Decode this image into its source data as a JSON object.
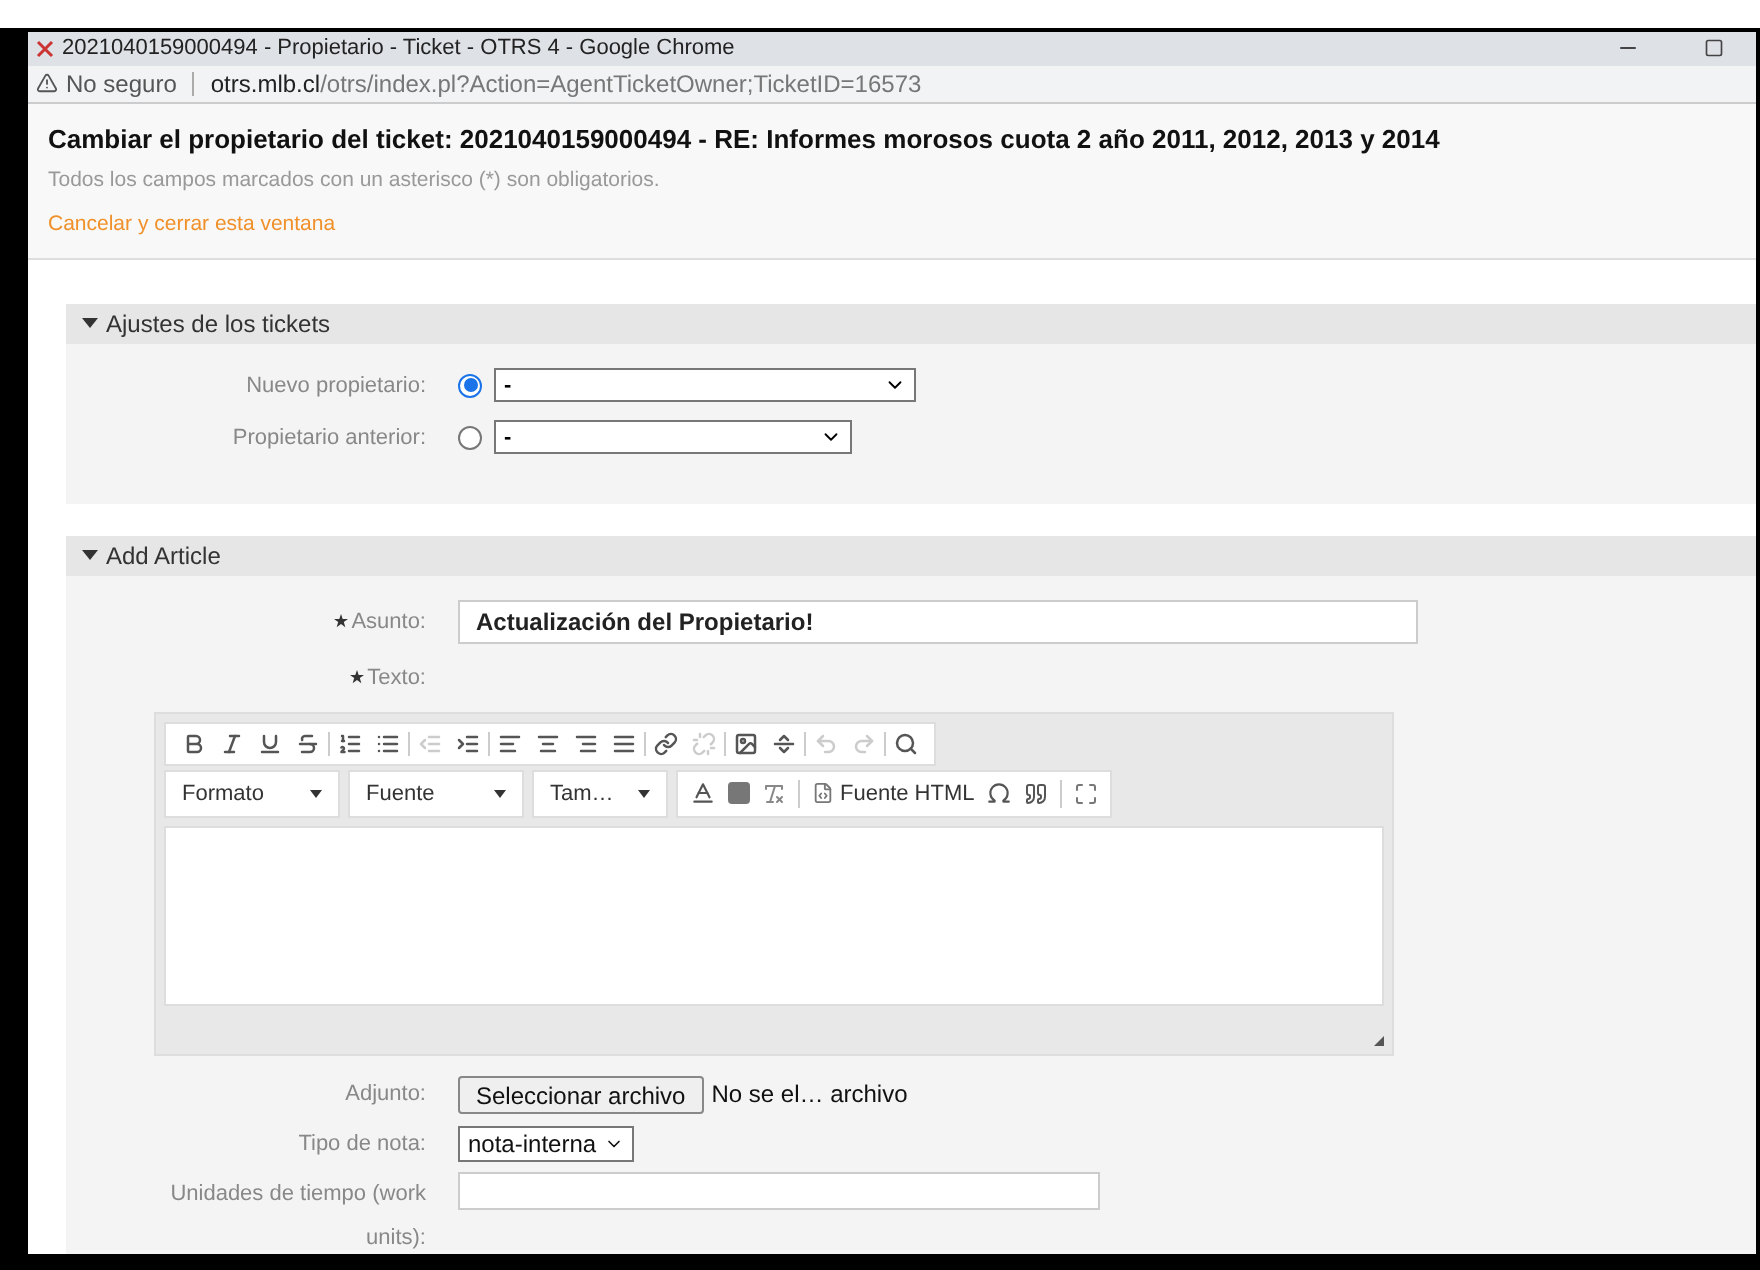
{
  "window": {
    "title": "2021040159000494 - Propietario - Ticket - OTRS 4 - Google Chrome"
  },
  "address_bar": {
    "security": "No seguro",
    "host": "otrs.mlb.cl",
    "path": "/otrs/index.pl?Action=AgentTicketOwner;TicketID=16573"
  },
  "header": {
    "title": "Cambiar el propietario del ticket: 2021040159000494 - RE: Informes morosos cuota 2 año 2011, 2012, 2013 y 2014",
    "note": "Todos los campos marcados con un asterisco (*) son obligatorios.",
    "cancel_link": "Cancelar y cerrar esta ventana"
  },
  "settings_section": {
    "title": "Ajustes de los tickets",
    "expanded": true,
    "fields": [
      {
        "label": "Nuevo propietario:",
        "selected": true,
        "value": "-"
      },
      {
        "label": "Propietario anterior:",
        "selected": false,
        "value": "-"
      }
    ]
  },
  "article_section": {
    "title": "Add Article",
    "expanded": true,
    "subject": {
      "label": "Asunto:",
      "required": true,
      "value": "Actualización del Propietario!"
    },
    "text": {
      "label": "Texto:",
      "required": true
    },
    "toolbar": [
      [
        {
          "kind": "bold",
          "disabled": false
        },
        {
          "kind": "italic",
          "disabled": false
        },
        {
          "kind": "underline",
          "disabled": false
        },
        {
          "kind": "strike",
          "disabled": false
        }
      ],
      [
        {
          "kind": "ordered-list",
          "disabled": false
        },
        {
          "kind": "bullet-list",
          "disabled": false
        }
      ],
      [
        {
          "kind": "outdent",
          "disabled": true
        },
        {
          "kind": "indent",
          "disabled": false
        }
      ],
      [
        {
          "kind": "align-left",
          "disabled": false
        },
        {
          "kind": "align-center",
          "disabled": false
        },
        {
          "kind": "align-right",
          "disabled": false
        },
        {
          "kind": "justify",
          "disabled": false
        }
      ],
      [
        {
          "kind": "link",
          "disabled": false
        },
        {
          "kind": "unlink",
          "disabled": true
        }
      ],
      [
        {
          "kind": "image",
          "disabled": false
        },
        {
          "kind": "rule",
          "disabled": false
        }
      ],
      [
        {
          "kind": "undo",
          "disabled": true
        },
        {
          "kind": "redo",
          "disabled": true
        }
      ],
      [
        {
          "kind": "search",
          "disabled": false
        }
      ]
    ],
    "dropdowns": [
      "Formato",
      "Fuente",
      "Tam…"
    ],
    "source_button": "Fuente HTML",
    "attachment": {
      "label": "Adjunto:",
      "button": "Seleccionar archivo",
      "status": "No se el… archivo"
    },
    "note_type": {
      "label": "Tipo de nota:",
      "value": "nota-interna"
    },
    "time_units": {
      "label": "Unidades de tiempo (work units):"
    }
  }
}
